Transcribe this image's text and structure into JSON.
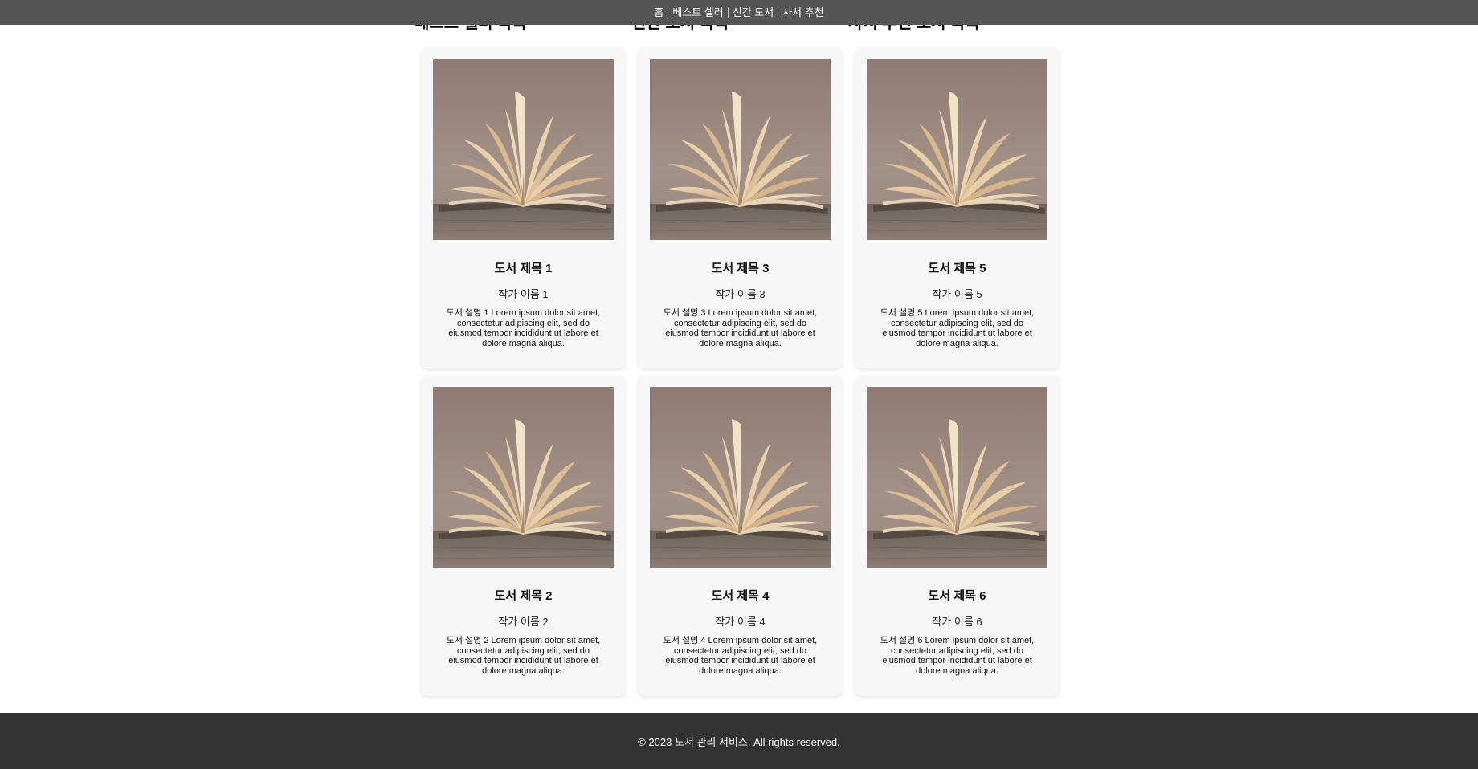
{
  "nav": {
    "items": [
      "홈",
      "베스트 셀러",
      "신간 도서",
      "사서 추천"
    ]
  },
  "sections": {
    "bestseller_title": "베스트 셀러 목록",
    "new_title": "신간 도서 목록",
    "recommend_title": "사서 추천 도서 목록"
  },
  "books": [
    {
      "title": "도서 제목 1",
      "author": "작가 이름 1",
      "description": "도서 설명 1 Lorem ipsum dolor sit amet, consectetur adipiscing elit, sed do eiusmod tempor incididunt ut labore et dolore magna aliqua."
    },
    {
      "title": "도서 제목 2",
      "author": "작가 이름 2",
      "description": "도서 설명 2 Lorem ipsum dolor sit amet, consectetur adipiscing elit, sed do eiusmod tempor incididunt ut labore et dolore magna aliqua."
    },
    {
      "title": "도서 제목 3",
      "author": "작가 이름 3",
      "description": "도서 설명 3 Lorem ipsum dolor sit amet, consectetur adipiscing elit, sed do eiusmod tempor incididunt ut labore et dolore magna aliqua."
    },
    {
      "title": "도서 제목 4",
      "author": "작가 이름 4",
      "description": "도서 설명 4 Lorem ipsum dolor sit amet, consectetur adipiscing elit, sed do eiusmod tempor incididunt ut labore et dolore magna aliqua."
    },
    {
      "title": "도서 제목 5",
      "author": "작가 이름 5",
      "description": "도서 설명 5 Lorem ipsum dolor sit amet, consectetur adipiscing elit, sed do eiusmod tempor incididunt ut labore et dolore magna aliqua."
    },
    {
      "title": "도서 제목 6",
      "author": "작가 이름 6",
      "description": "도서 설명 6 Lorem ipsum dolor sit amet, consectetur adipiscing elit, sed do eiusmod tempor incididunt ut labore et dolore magna aliqua."
    }
  ],
  "footer": {
    "copyright": "© 2023 도서 관리 서비스. All rights reserved."
  },
  "colors": {
    "nav_bg": "#555555",
    "footer_bg": "#333333",
    "card_bg": "#f7f7f7"
  }
}
